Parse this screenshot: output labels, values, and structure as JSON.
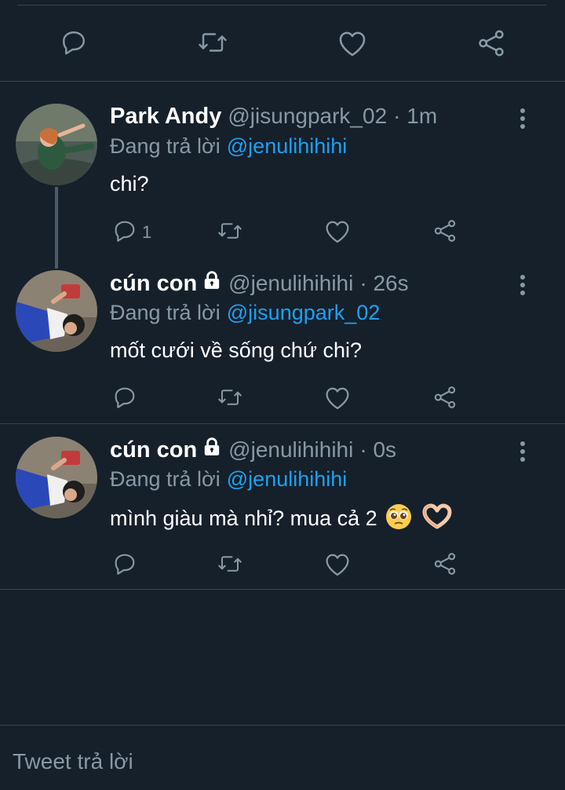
{
  "colors": {
    "background": "#15202b",
    "accent": "#1da1f2",
    "muted": "#8899a6",
    "divider": "#38444d"
  },
  "top_actions": {
    "icons": [
      "reply-icon",
      "retweet-icon",
      "like-icon",
      "share-icon"
    ]
  },
  "tweets": [
    {
      "name": "Park Andy",
      "handle": "@jisungpark_02",
      "time": "· 1m",
      "reply_prefix": "Đang trả lời",
      "reply_to": "@jenulihihihi",
      "text": "chi?",
      "reply_count": "1",
      "protected": false
    },
    {
      "name": "cún con",
      "handle": "@jenulihihihi",
      "time": "· 26s",
      "reply_prefix": "Đang trả lời",
      "reply_to": "@jisungpark_02",
      "text": "mốt cưới về sống chứ chi?",
      "reply_count": "",
      "protected": true
    },
    {
      "name": "cún con",
      "handle": "@jenulihihihi",
      "time": "· 0s",
      "reply_prefix": "Đang trả lời",
      "reply_to": "@jenulihihihi",
      "text": "mình giàu mà nhỉ? mua cả 2",
      "emojis": [
        "pleading-face-emoji",
        "heart-hands-emoji"
      ],
      "reply_count": "",
      "protected": true
    }
  ],
  "composer": {
    "placeholder": "Tweet trả lời"
  }
}
